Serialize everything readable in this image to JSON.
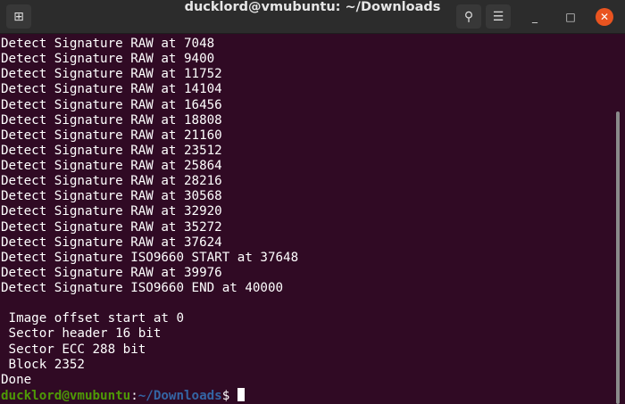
{
  "window": {
    "title": "ducklord@vmubuntu: ~/Downloads"
  },
  "lines": [
    "Detect Signature RAW at 7048",
    "Detect Signature RAW at 9400",
    "Detect Signature RAW at 11752",
    "Detect Signature RAW at 14104",
    "Detect Signature RAW at 16456",
    "Detect Signature RAW at 18808",
    "Detect Signature RAW at 21160",
    "Detect Signature RAW at 23512",
    "Detect Signature RAW at 25864",
    "Detect Signature RAW at 28216",
    "Detect Signature RAW at 30568",
    "Detect Signature RAW at 32920",
    "Detect Signature RAW at 35272",
    "Detect Signature RAW at 37624",
    "Detect Signature ISO9660 START at 37648",
    "Detect Signature RAW at 39976",
    "Detect Signature ISO9660 END at 40000",
    "",
    " Image offset start at 0",
    " Sector header 16 bit",
    " Sector ECC 288 bit",
    " Block 2352",
    "Done"
  ],
  "prompt": {
    "user_host": "ducklord@vmubuntu",
    "sep": ":",
    "path": "~/Downloads",
    "symbol": "$ "
  }
}
